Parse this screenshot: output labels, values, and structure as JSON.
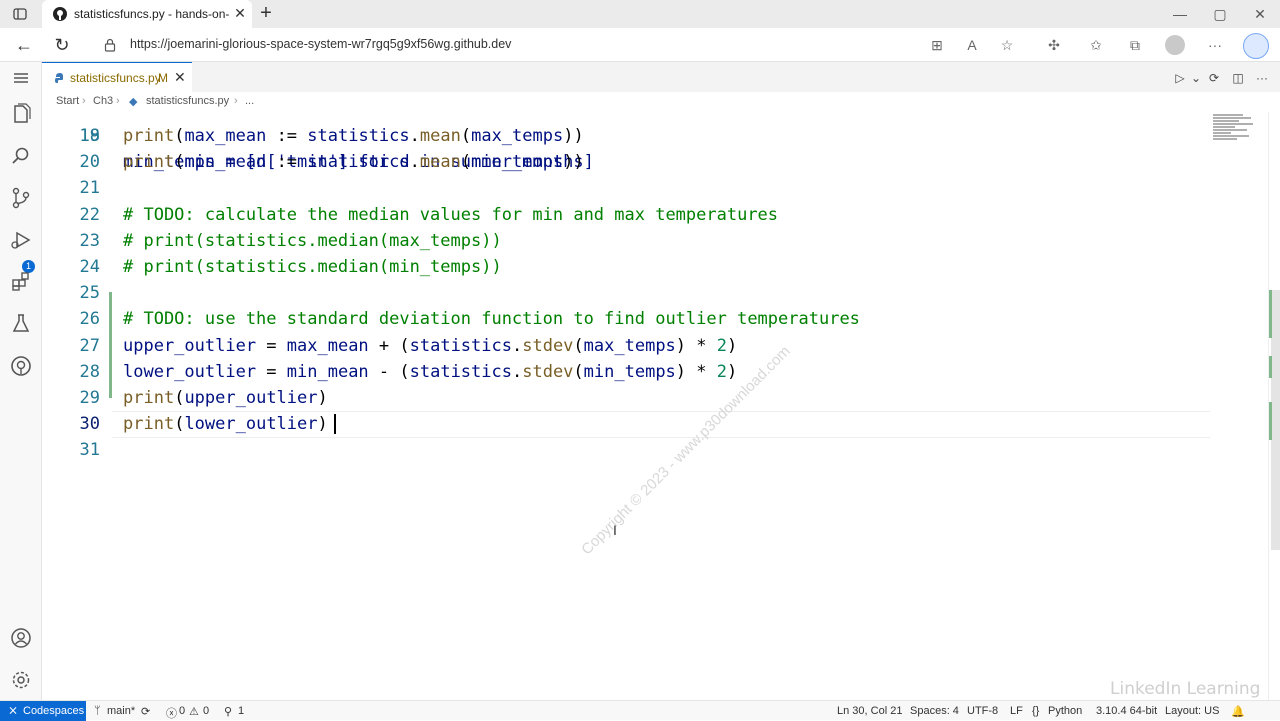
{
  "browser": {
    "tab_title": "statisticsfuncs.py - hands-on-adv",
    "url": "https://joemarini-glorious-space-system-wr7rgq5g9xf56wg.github.dev"
  },
  "editor_tab": {
    "filename": "statisticsfuncs.py",
    "modified": "M"
  },
  "breadcrumbs": [
    "Start",
    "Ch3",
    "statisticsfuncs.py",
    "..."
  ],
  "code": {
    "partial_line": "min_temps = [d['tmin'] for d in summer_months]",
    "lines": [
      {
        "n": "19",
        "text": "print(max_mean := statistics.mean(max_temps))"
      },
      {
        "n": "20",
        "text": "print(min_mean := statistics.mean(min_temps))"
      },
      {
        "n": "21",
        "text": ""
      },
      {
        "n": "22",
        "text": "# TODO: calculate the median values for min and max temperatures"
      },
      {
        "n": "23",
        "text": "# print(statistics.median(max_temps))"
      },
      {
        "n": "24",
        "text": "# print(statistics.median(min_temps))"
      },
      {
        "n": "25",
        "text": ""
      },
      {
        "n": "26",
        "text": "# TODO: use the standard deviation function to find outlier temperatures"
      },
      {
        "n": "27",
        "text": "upper_outlier = max_mean + (statistics.stdev(max_temps) * 2)"
      },
      {
        "n": "28",
        "text": "lower_outlier = min_mean - (statistics.stdev(min_temps) * 2)"
      },
      {
        "n": "29",
        "text": "print(upper_outlier)"
      },
      {
        "n": "30",
        "text": "print(lower_outlier)"
      },
      {
        "n": "31",
        "text": ""
      }
    ],
    "line_18_label": "18"
  },
  "watermark": "Copyright © 2023 - www.p30download.com",
  "status": {
    "remote": "Codespaces",
    "branch": "main*",
    "errors": "0",
    "warnings": "0",
    "ports": "1",
    "position": "Ln 30, Col 21",
    "spaces": "Spaces: 4",
    "encoding": "UTF-8",
    "eol": "LF",
    "language": "Python",
    "interpreter": "3.10.4 64-bit",
    "layout": "Layout: US"
  },
  "branding": "LinkedIn Learning",
  "colors": {
    "accent": "#0a69d2",
    "line_numbers": "#237893",
    "function": "#795e26",
    "variable": "#001080",
    "comment": "#008000",
    "number": "#098658",
    "git_modified": "#81b88b"
  },
  "icons": {
    "activity_bar": [
      "menu-icon",
      "explorer-icon",
      "search-icon",
      "source-control-icon",
      "run-debug-icon",
      "extensions-icon",
      "testing-icon",
      "github-icon",
      "accounts-icon",
      "settings-gear-icon"
    ]
  }
}
